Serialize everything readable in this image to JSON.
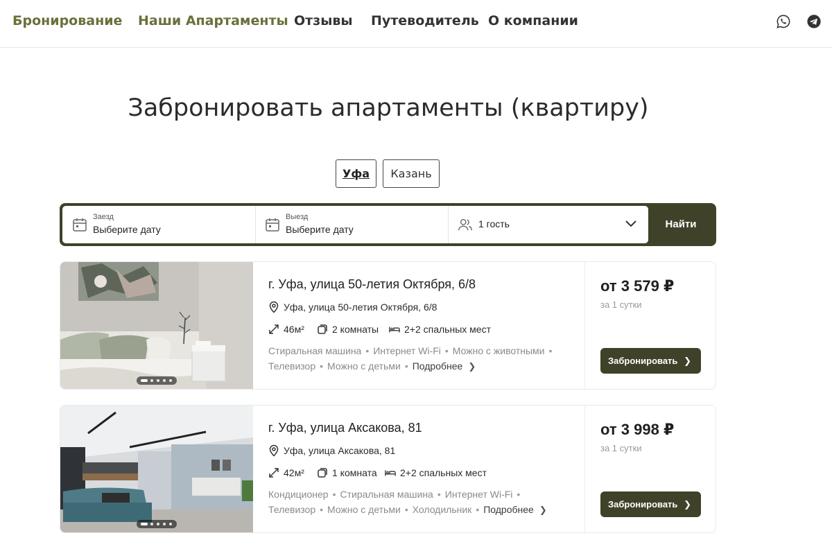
{
  "nav": {
    "items": [
      {
        "label": "Бронирование"
      },
      {
        "label": "Наши Апартаменты"
      },
      {
        "label": "Отзывы"
      },
      {
        "label": "Путеводитель"
      },
      {
        "label": "О компании"
      }
    ],
    "social": [
      "whatsapp-icon",
      "telegram-icon"
    ]
  },
  "page": {
    "title": "Забронировать апартаменты (квартиру)"
  },
  "cities": {
    "selected": "Уфа",
    "items": [
      {
        "label": "Уфа"
      },
      {
        "label": "Казань"
      }
    ]
  },
  "search": {
    "checkin": {
      "label": "Заезд",
      "value": "Выберите дату"
    },
    "checkout": {
      "label": "Выезд",
      "value": "Выберите дату"
    },
    "guests": {
      "value": "1 гость"
    },
    "button": "Найти"
  },
  "listings": [
    {
      "title": "г. Уфа, улица 50-летия Октября, 6/8",
      "address": "Уфа, улица 50-летия Октября, 6/8",
      "area": "46м²",
      "rooms": "2 комнаты",
      "beds": "2+2 спальных мест",
      "amenities_line1": [
        "Стиральная машина",
        "Интернет Wi-Fi",
        "Можно с животными"
      ],
      "amenities_line2": [
        "Телевизор",
        "Можно с детьми"
      ],
      "more": "Подробнее",
      "price": "от 3 579 ₽",
      "per": "за 1 сутки",
      "book": "Забронировать"
    },
    {
      "title": "г. Уфа, улица Аксакова, 81",
      "address": "Уфа, улица Аксакова, 81",
      "area": "42м²",
      "rooms": "1 комната",
      "beds": "2+2 спальных мест",
      "amenities_line1": [
        "Кондиционер",
        "Стиральная машина",
        "Интернет Wi-Fi"
      ],
      "amenities_line2": [
        "Телевизор",
        "Можно с детьми",
        "Холодильник"
      ],
      "more": "Подробнее",
      "price": "от 3 998 ₽",
      "per": "за 1 сутки",
      "book": "Забронировать"
    }
  ],
  "colors": {
    "accent": "#6b6f3a",
    "button_dark": "#3f4228"
  }
}
